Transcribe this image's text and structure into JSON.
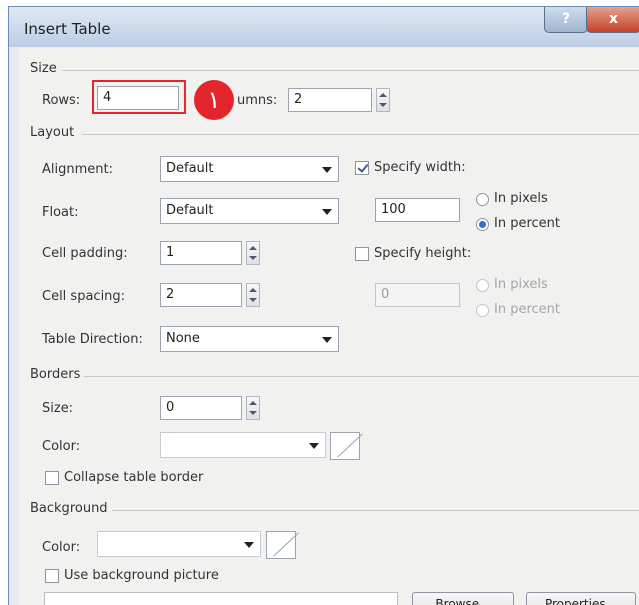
{
  "dialog": {
    "title": "Insert Table",
    "help_glyph": "?",
    "close_glyph": "x"
  },
  "callout": {
    "number": "١"
  },
  "size": {
    "section": "Size",
    "rows_label": "Rows:",
    "rows_value": "4",
    "columns_label": "umns:",
    "columns_value": "2"
  },
  "layout": {
    "section": "Layout",
    "alignment_label": "Alignment:",
    "alignment_value": "Default",
    "float_label": "Float:",
    "float_value": "Default",
    "cell_padding_label": "Cell padding:",
    "cell_padding_value": "1",
    "cell_spacing_label": "Cell spacing:",
    "cell_spacing_value": "2",
    "table_direction_label": "Table Direction:",
    "table_direction_value": "None",
    "specify_width_label": "Specify width:",
    "specify_width_checked": true,
    "width_value": "100",
    "width_in_pixels_label": "In pixels",
    "width_in_percent_label": "In percent",
    "width_unit_selected": "percent",
    "specify_height_label": "Specify height:",
    "specify_height_checked": false,
    "height_value": "0",
    "height_in_pixels_label": "In pixels",
    "height_in_percent_label": "In percent"
  },
  "borders": {
    "section": "Borders",
    "size_label": "Size:",
    "size_value": "0",
    "color_label": "Color:",
    "collapse_label": "Collapse table border",
    "collapse_checked": false
  },
  "background": {
    "section": "Background",
    "color_label": "Color:",
    "use_picture_label": "Use background picture",
    "use_picture_checked": false,
    "browse_label": "Browse...",
    "properties_label": "Properties..."
  },
  "colors": {
    "accent_red": "#e3262d",
    "titlebar": "#bccde3",
    "close_button": "#c4412a"
  }
}
